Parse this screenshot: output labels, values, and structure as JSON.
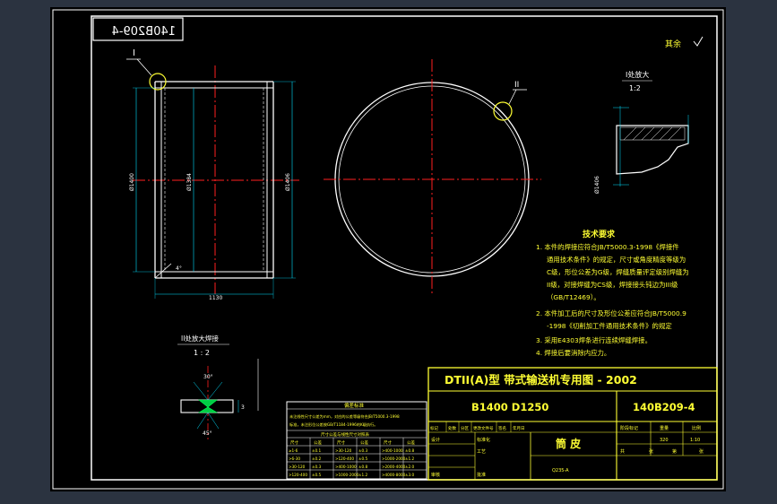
{
  "drawing": {
    "mirrored_code": "140B209-4",
    "material_note": "其余",
    "view_label_I": "I",
    "view_label_II": "II",
    "dims": {
      "left_dia": "Ø1400",
      "inner_dia": "Ø1384",
      "right_dia": "Ø1406",
      "length": "1130",
      "chamfer": "4°",
      "detail_dia": "Ø1406"
    },
    "detail_I": {
      "title": "I处放大",
      "scale": "1:2"
    },
    "detail_II": {
      "title": "II处放大焊接",
      "scale": "1 : 2",
      "angle_top": "30°",
      "angle_bottom": "45°",
      "gap": "3"
    },
    "tech": {
      "title": "技术要求",
      "lines": [
        "1. 本件的焊接应符合JB/T5000.3-1998《焊接件",
        "通用技术条件》的规定，尺寸或角度精度等级为",
        "C级，形位公差为G级，焊缝质量评定级别焊缝为",
        "II级，对接焊缝为CS级，焊接接头钝边为III级",
        "（GB/T12469）。",
        "2. 本件加工后的尺寸及形位公差应符合JB/T5000.9",
        "-1998《切削加工件通用技术条件》的规定",
        "3. 采用E4303焊条进行连续焊缝焊接。",
        "4. 焊接后要消除内应力。"
      ]
    },
    "tolerance_table": {
      "title": "偏差标准",
      "note_lines": [
        "未注线性尺寸公差为mm，对应的公差等级符合JB/T5000.3-1998",
        "标准，未注形位公差按GB/T1184-1996的K级执行。"
      ],
      "subtitle": "尺寸公差与线性尺寸对照表",
      "headers": [
        "尺寸",
        "公差",
        "尺寸",
        "公差",
        "尺寸",
        "公差"
      ],
      "rows": [
        [
          "≥1-6",
          "±0.1",
          ">30-120",
          "±0.3",
          ">400-1000",
          "±0.8"
        ],
        [
          ">6-30",
          "±0.2",
          ">120-400",
          "±0.5",
          ">1000-2000",
          "±1.2"
        ],
        [
          ">30-120",
          "±0.3",
          ">400-1000",
          "±0.8",
          ">2000-4000",
          "±2.0"
        ],
        [
          ">120-400",
          "±0.5",
          ">1000-2000",
          "±1.2",
          ">4000-8000",
          "±3.0"
        ]
      ]
    },
    "title_block": {
      "main_title": "DTII(A)型  带式输送机专用图 - 2002",
      "spec": "B1400 D1250",
      "code": "140B209-4",
      "part_name": "筒 皮",
      "material": "Q235-A",
      "mark_headers": [
        "标记",
        "处数",
        "分区",
        "更改文件号",
        "签名",
        "年月日"
      ],
      "role_labels": [
        "设计",
        "工艺",
        "标准化",
        "审核",
        "批准"
      ],
      "side_headers": [
        "阶段标记",
        "重量",
        "比例"
      ],
      "weight": "320",
      "scale": "1:10",
      "sheet_labels": [
        "共",
        "张",
        "第",
        "张"
      ]
    }
  }
}
